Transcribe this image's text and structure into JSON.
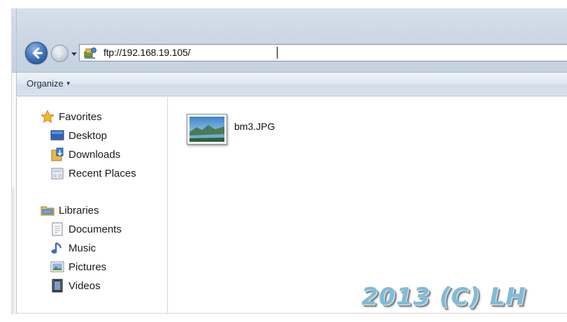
{
  "address_bar": {
    "url": "ftp://192.168.19.105/",
    "icon": "ftp-site-icon"
  },
  "toolbar": {
    "organize_label": "Organize"
  },
  "nav_pane": {
    "favorites": {
      "label": "Favorites",
      "icon": "star-icon",
      "items": [
        {
          "label": "Desktop",
          "icon": "desktop-icon"
        },
        {
          "label": "Downloads",
          "icon": "downloads-icon"
        },
        {
          "label": "Recent Places",
          "icon": "recent-places-icon"
        }
      ]
    },
    "libraries": {
      "label": "Libraries",
      "icon": "library-icon",
      "items": [
        {
          "label": "Documents",
          "icon": "documents-icon"
        },
        {
          "label": "Music",
          "icon": "music-icon"
        },
        {
          "label": "Pictures",
          "icon": "pictures-icon"
        },
        {
          "label": "Videos",
          "icon": "videos-icon"
        }
      ]
    }
  },
  "files": [
    {
      "name": "bm3.JPG",
      "icon": "image-thumbnail"
    }
  ],
  "watermark": "2013 (C) LH",
  "colors": {
    "accent": "#3a6fb8",
    "glass": "#cfd9e6",
    "watermark": "#7fbcd8"
  }
}
